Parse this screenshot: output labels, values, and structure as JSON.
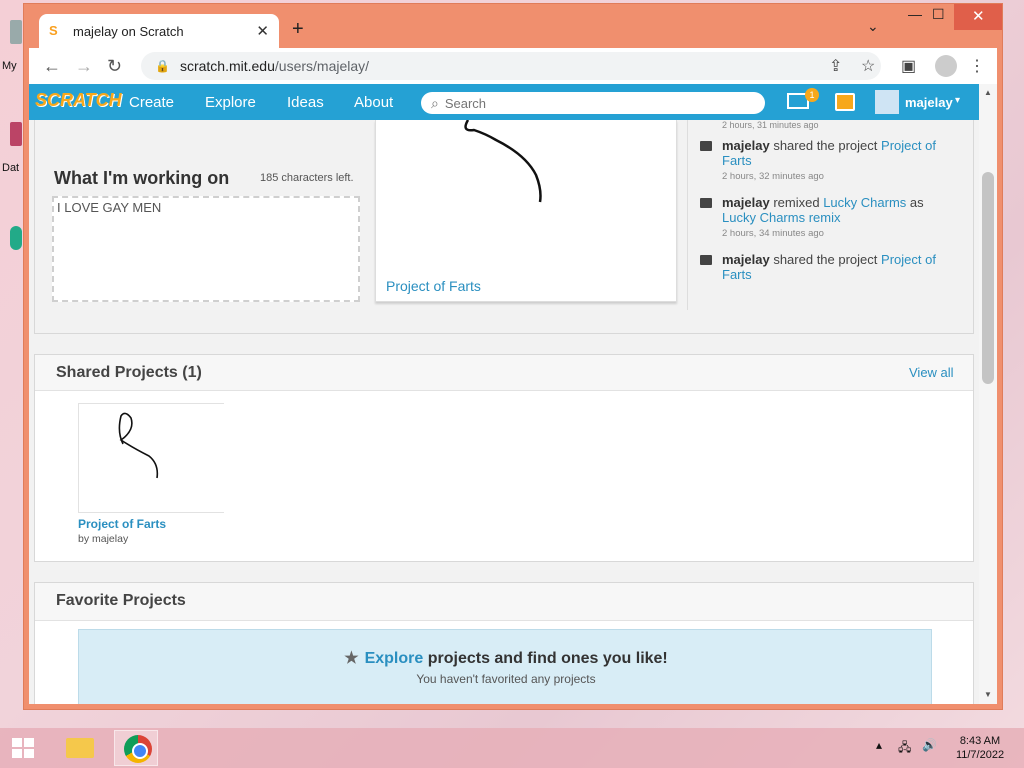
{
  "browser": {
    "tab_title": "majelay on Scratch",
    "url_host": "scratch.mit.edu",
    "url_path": "/users/majelay/"
  },
  "scratch_nav": {
    "logo": "SCRATCH",
    "links": [
      "Create",
      "Explore",
      "Ideas",
      "About"
    ],
    "search_placeholder": "Search",
    "messages_count": "1",
    "username": "majelay"
  },
  "profile": {
    "working_on_title": "What I'm working on",
    "chars_left": "185 characters left.",
    "working_on_text": "I LOVE GAY MEN",
    "featured_project_title": "Project of Farts"
  },
  "activity": {
    "clipped_time": "2 hours, 31 minutes ago",
    "items": [
      {
        "user": "majelay",
        "action": "shared the project",
        "target": "Project of Farts",
        "extra_pre": "",
        "extra": "",
        "time": "2 hours, 32 minutes ago"
      },
      {
        "user": "majelay",
        "action": "remixed",
        "target": "Lucky Charms",
        "extra_pre": "as",
        "extra": "Lucky Charms remix",
        "time": "2 hours, 34 minutes ago"
      },
      {
        "user": "majelay",
        "action": "shared the project",
        "target": "Project of Farts",
        "extra_pre": "",
        "extra": "",
        "time": ""
      }
    ]
  },
  "shared_projects": {
    "title": "Shared Projects (1)",
    "view_all": "View all",
    "project_name": "Project of Farts",
    "project_by": "by majelay"
  },
  "favorite_projects": {
    "title": "Favorite Projects",
    "explore_link": "Explore",
    "explore_rest": "projects and find ones you like!",
    "empty_text": "You haven't favorited any projects"
  },
  "desktop_labels": [
    "My",
    "Dat"
  ],
  "taskbar": {
    "time": "8:43 AM",
    "date": "11/7/2022"
  },
  "colors": {
    "scratch_blue": "#25a1d4",
    "link_blue": "#2a8fc0",
    "window_frame": "#f08f6e",
    "favorite_panel": "#d8edf6"
  }
}
